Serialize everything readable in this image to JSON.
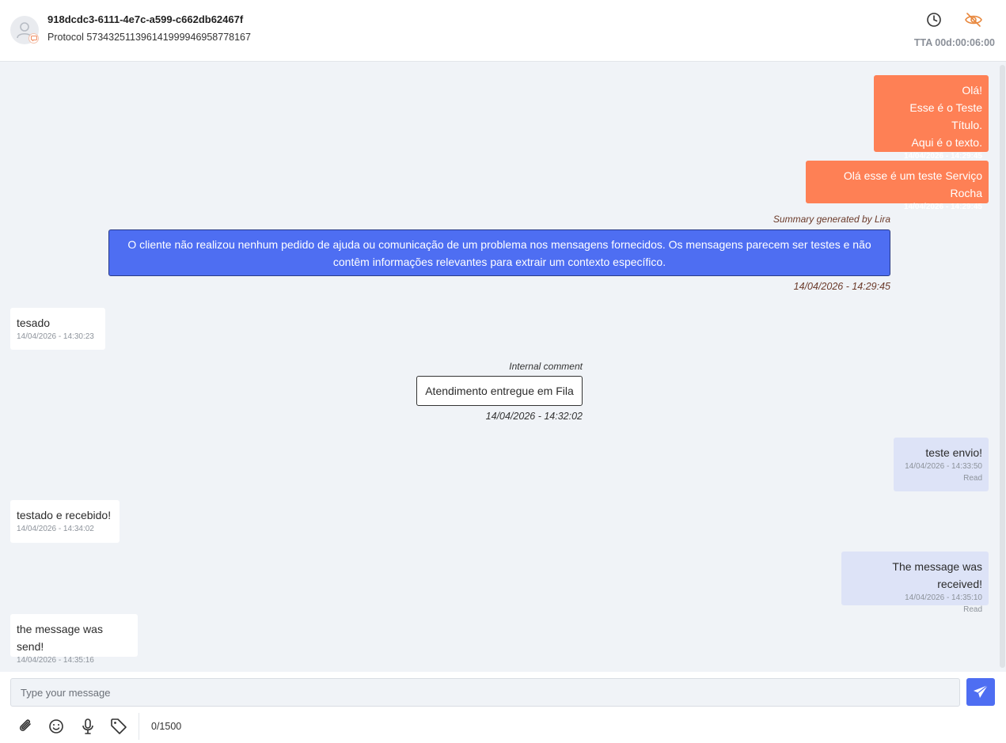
{
  "header": {
    "conversation_id": "918dcdc3-6111-4e7c-a599-c662db62467f",
    "protocol": "Protocol 573432511396141999946958778167",
    "tta": "TTA 00d:00:06:00"
  },
  "messages": {
    "m1": {
      "lines": [
        "Olá!",
        "Esse é o Teste Título.",
        "Aqui é o texto."
      ],
      "time": "14/04/2026 - 14:29:45"
    },
    "m2": {
      "text": "Olá esse é um teste Serviço Rocha",
      "time": "14/04/2026 - 14:29:45"
    },
    "summary": {
      "label": "Summary generated by Lira",
      "text": "O cliente não realizou nenhum pedido de ajuda ou comunicação de um problema nos mensagens fornecidos. Os mensagens parecem ser testes e não contêm informações relevantes para extrair um contexto específico.",
      "time": "14/04/2026 - 14:29:45"
    },
    "m3": {
      "text": "tesado",
      "time": "14/04/2026 - 14:30:23"
    },
    "comment": {
      "label": "Internal comment",
      "text": "Atendimento entregue em Fila",
      "time": "14/04/2026 - 14:32:02"
    },
    "m4": {
      "text": "teste envio!",
      "time": "14/04/2026 - 14:33:50",
      "status": "Read"
    },
    "m5": {
      "text": "testado e recebido!",
      "time": "14/04/2026 - 14:34:02"
    },
    "m6": {
      "text": "The message was received!",
      "time": "14/04/2026 - 14:35:10",
      "status": "Read"
    },
    "m7": {
      "text": "the message was send!",
      "time": "14/04/2026 - 14:35:16"
    }
  },
  "composer": {
    "placeholder": "Type your message",
    "char_count": "0/1500"
  },
  "icons": [
    "avatar-user-icon",
    "channel-badge-icon",
    "clock-icon",
    "eye-off-icon",
    "send-icon",
    "paperclip-icon",
    "emoji-icon",
    "microphone-icon",
    "tag-icon"
  ],
  "colors": {
    "outgoing_orange": "#fe8055",
    "summary_blue": "#4e6ef2",
    "outgoing_light": "#dde3f7",
    "eye_off_orange": "#e8883e",
    "chat_bg": "#f0f3f7"
  }
}
